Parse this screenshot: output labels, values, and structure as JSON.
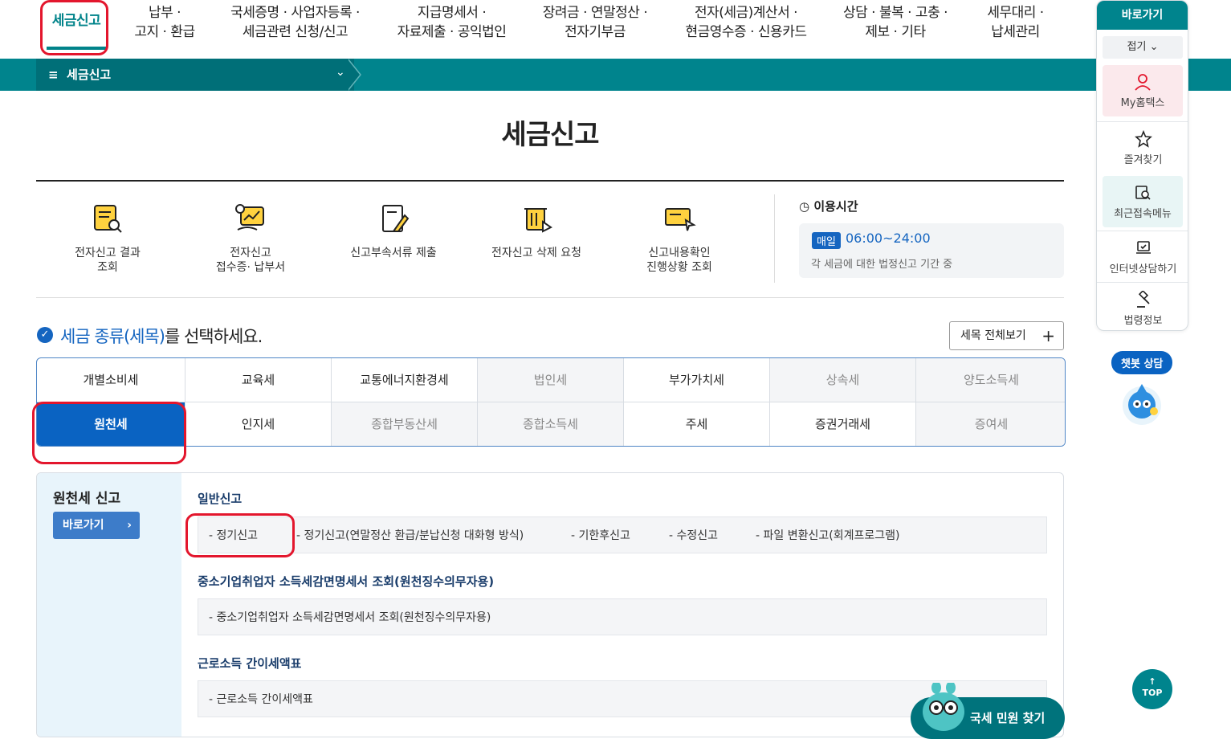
{
  "top_nav": {
    "items": [
      {
        "label1": "세금신고",
        "label2": ""
      },
      {
        "label1": "납부 ·",
        "label2": "고지 · 환급"
      },
      {
        "label1": "국세증명 · 사업자등록 ·",
        "label2": "세금관련 신청/신고"
      },
      {
        "label1": "지급명세서 ·",
        "label2": "자료제출 · 공익법인"
      },
      {
        "label1": "장려금 · 연말정산 ·",
        "label2": "전자기부금"
      },
      {
        "label1": "전자(세금)계산서 ·",
        "label2": "현금영수증 · 신용카드"
      },
      {
        "label1": "상담 · 불복 · 고충 ·",
        "label2": "제보 · 기타"
      },
      {
        "label1": "세무대리 ·",
        "label2": "납세관리"
      }
    ]
  },
  "breadcrumb": {
    "menu_icon": "hamburger-icon",
    "label": "세금신고"
  },
  "page_title": "세금신고",
  "quick_menu": [
    {
      "line1": "전자신고 결과",
      "line2": "조회",
      "icon": "document-search-icon"
    },
    {
      "line1": "전자신고",
      "line2": "접수증· 납부서",
      "icon": "receipt-hand-icon"
    },
    {
      "line1": "신고부속서류 제출",
      "line2": "",
      "icon": "document-pen-icon"
    },
    {
      "line1": "전자신고 삭제 요청",
      "line2": "",
      "icon": "trash-click-icon"
    },
    {
      "line1": "신고내용확인",
      "line2": "진행상황 조회",
      "icon": "monitor-cursor-icon"
    }
  ],
  "hours": {
    "title": "이용시간",
    "badge": "매일",
    "time": "06:00~24:00",
    "note": "각 세금에 대한 법정신고 기간 중"
  },
  "select": {
    "prefix": "세금 종류(세목)",
    "suffix": "를 선택하세요.",
    "all_button": "세목 전체보기",
    "plus": "+"
  },
  "tax_types": {
    "row1": [
      "개별소비세",
      "교육세",
      "교통에너지환경세",
      "법인세",
      "부가가치세",
      "상속세",
      "양도소득세"
    ],
    "row2": [
      "원천세",
      "인지세",
      "종합부동산세",
      "종합소득세",
      "주세",
      "증권거래세",
      "증여세"
    ]
  },
  "panel": {
    "title": "원천세 신고",
    "go_label": "바로가기",
    "go_arrow": "›",
    "sections": [
      {
        "head": "일반신고",
        "links": [
          "-  정기신고",
          "-  정기신고(연말정산 환급/분납신청 대화형 방식)",
          "-  기한후신고",
          "-  수정신고",
          "-  파일 변환신고(회계프로그램)"
        ]
      },
      {
        "head": "중소기업취업자 소득세감면명세서 조회(원천징수의무자용)",
        "links": [
          "-  중소기업취업자 소득세감면명세서 조회(원천징수의무자용)"
        ]
      },
      {
        "head": "근로소득 간이세액표",
        "links": [
          "-  근로소득 간이세액표"
        ]
      }
    ]
  },
  "right_menu": {
    "head": "바로가기",
    "fold": "접기 ⌄",
    "items": [
      "My홈택스",
      "즐겨찾기",
      "최근접속메뉴",
      "인터넷상담하기",
      "법령정보"
    ]
  },
  "chatbot": {
    "label": "챗봇 상담"
  },
  "top_button": {
    "arrow": "↑",
    "label": "TOP"
  },
  "minwon_button": {
    "label": "국세 민원 찾기"
  },
  "colors": {
    "teal": "#00848d",
    "blue": "#0a63c2",
    "highlight_red": "#e3162d"
  }
}
